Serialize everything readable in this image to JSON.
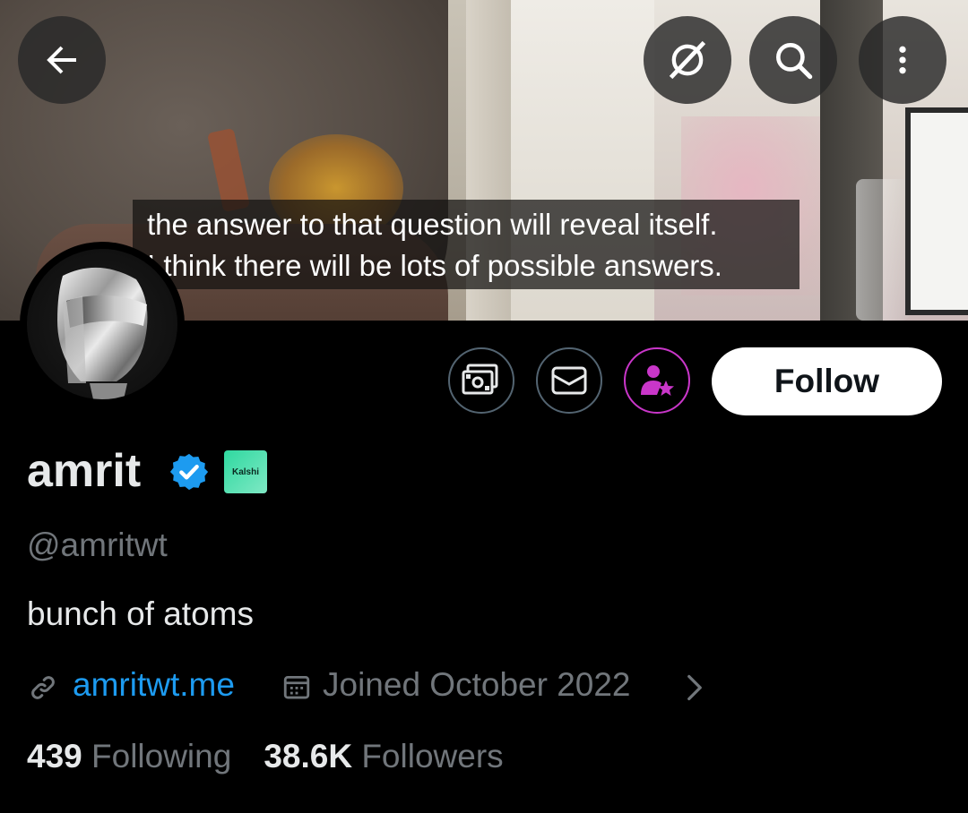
{
  "banner": {
    "caption_line1": "the answer to that question will reveal itself.",
    "caption_line2": "I think there will be lots of possible answers."
  },
  "top_actions": {
    "back": "arrow-left-icon",
    "grok": "grok-slash-icon",
    "search": "search-icon",
    "more": "more-vertical-icon"
  },
  "actions": {
    "tip": "money-icon",
    "message": "envelope-icon",
    "subscribe": "subscribe-person-star-icon",
    "follow_label": "Follow",
    "subscribe_color": "#c936c9"
  },
  "profile": {
    "name": "amrit",
    "affiliation_badge": "Kalshi",
    "handle": "@amritwt",
    "bio": "bunch of atoms",
    "website": "amritwt.me",
    "joined": "Joined October 2022",
    "following_count": "439",
    "following_label": "Following",
    "followers_count": "38.6K",
    "followers_label": "Followers"
  },
  "colors": {
    "background": "#000000",
    "link": "#1d9bf0",
    "muted": "#71767b",
    "verified": "#1d9bf0"
  }
}
